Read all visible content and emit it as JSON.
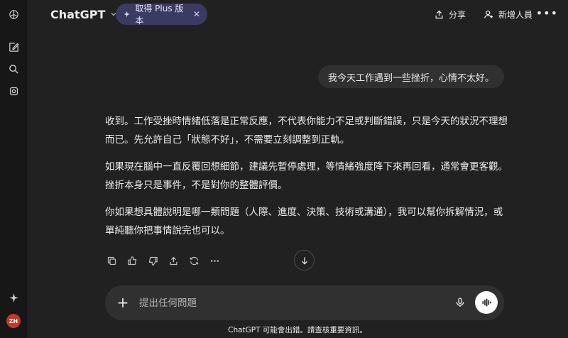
{
  "header": {
    "brand": "ChatGPT",
    "upgrade_label": "取得 Plus 版本",
    "share_label": "分享",
    "add_people_label": "新增人員"
  },
  "sidebar": {
    "icons": [
      "openai-logo-icon",
      "new-chat-icon",
      "search-icon",
      "library-icon",
      "sparkle-icon"
    ],
    "avatar_initials": "ZH"
  },
  "conversation": {
    "user_message": "我今天工作遇到一些挫折，心情不太好。",
    "assistant_paragraphs": [
      "收到。工作受挫時情緒低落是正常反應，不代表你能力不足或判斷錯誤，只是今天的狀況不理想而已。先允許自己「狀態不好」，不需要立刻調整到正軌。",
      "如果現在腦中一直反覆回想細節，建議先暫停處理，等情緒強度降下來再回看，通常會更客觀。挫折本身只是事件，不是對你的整體評價。",
      "你如果想具體說明是哪一類問題（人際、進度、決策、技術或溝通），我可以幫你拆解情況，或單純聽你把事情說完也可以。"
    ],
    "actions": [
      "copy-icon",
      "thumbs-up-icon",
      "thumbs-down-icon",
      "share-icon",
      "regenerate-icon",
      "more-icon"
    ]
  },
  "composer": {
    "placeholder": "提出任何問題"
  },
  "footer": {
    "disclaimer": "ChatGPT 可能會出錯。請查核重要資訊。"
  },
  "colors": {
    "background": "#212121",
    "sidebar": "#171717",
    "bubble": "#303030",
    "upgrade_pill": "#3b3a63",
    "avatar": "#c0392b"
  }
}
